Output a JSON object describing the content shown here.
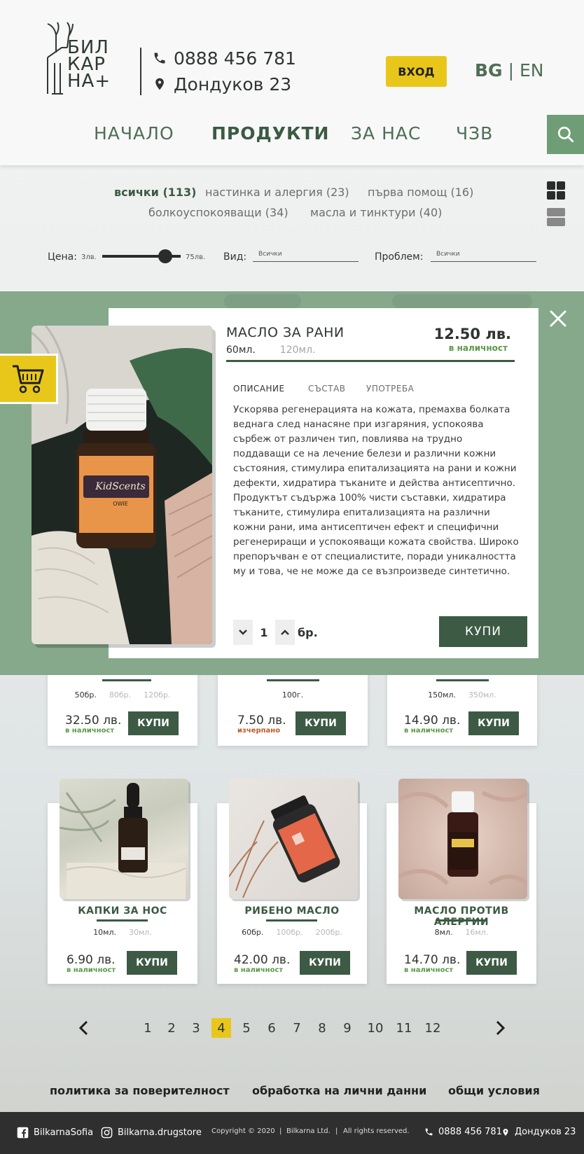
{
  "header": {
    "logo_text": [
      "БИЛ",
      "КАР",
      "НА+"
    ],
    "phone": "0888 456 781",
    "address": "Дондуков 23",
    "login_label": "ВХОД",
    "lang_bg": "BG",
    "lang_sep": "|",
    "lang_en": "EN"
  },
  "nav": {
    "items": [
      {
        "label": "НАЧАЛО"
      },
      {
        "label": "ПРОДУКТИ"
      },
      {
        "label": "ЗА НАС"
      },
      {
        "label": "ЧЗВ"
      }
    ]
  },
  "categories": [
    {
      "label": "всички (113)"
    },
    {
      "label": "настинка и алергия (23)"
    },
    {
      "label": "първа помощ (16)"
    },
    {
      "label": "болкоуспокояващи (34)"
    },
    {
      "label": "масла и тинктури (40)"
    }
  ],
  "filters": {
    "price_label": "Цена:",
    "price_min": "3лв.",
    "price_max": "75лв.",
    "price_level": 0.8,
    "type_label": "Вид:",
    "type_value": "Всички",
    "problem_label": "Проблем:",
    "problem_value": "Всички"
  },
  "products_row1": [
    {
      "sizes": [
        "50бр.",
        "80бр.",
        "120бр."
      ],
      "price": "32.50 лв.",
      "stock": "в наличност",
      "buy": "КУПИ"
    },
    {
      "sizes": [
        "100г."
      ],
      "price": "7.50 лв.",
      "stock": "изчерпано",
      "buy": "КУПИ"
    },
    {
      "sizes": [
        "150мл.",
        "350мл."
      ],
      "price": "14.90 лв.",
      "stock": "в наличност",
      "buy": "КУПИ"
    }
  ],
  "products_row2": [
    {
      "name": "КАПКИ ЗА НОС",
      "sizes": [
        "10мл.",
        "30мл."
      ],
      "price": "6.90 лв.",
      "stock": "в наличност",
      "buy": "КУПИ"
    },
    {
      "name": "РИБЕНО МАСЛО",
      "sizes": [
        "60бр.",
        "100бр.",
        "200бр."
      ],
      "price": "42.00 лв.",
      "stock": "в наличност",
      "buy": "КУПИ"
    },
    {
      "name": "МАСЛО ПРОТИВ АЛЕРГИИ",
      "sizes": [
        "8мл.",
        "16мл."
      ],
      "price": "14.70 лв.",
      "stock": "в наличност",
      "buy": "КУПИ"
    }
  ],
  "modal": {
    "title": "МАСЛО ЗА РАНИ",
    "price": "12.50 лв.",
    "stock": "в наличност",
    "size_selected": "60мл.",
    "size_other": "120мл.",
    "tabs": [
      {
        "label": "ОПИСАНИЕ"
      },
      {
        "label": "СЪСТАВ"
      },
      {
        "label": "УПОТРЕБА"
      }
    ],
    "description": "Ускорява регенерацията на кожата, премахва болката веднага след нанасяне при изгаряния, успокоява сърбеж от различен тип, повлиява на трудно поддаващи се на лечение белези и различни кожни състояния, стимулира епитализацията на рани и кожни дефекти, хидратира тъканите и действа антисептично. Продуктът съдържа 100% чисти съставки, хидратира тъканите, стимулира епитализацията на различни кожни рани, има антисептичен ефект и специфични регенериращи и успокояващи кожата свойства. Широко препоръчван е от специалистите, поради уникалността му и това, че не може да се възпроизведе синтетично.",
    "quantity": "1",
    "unit": "бр.",
    "buy_label": "КУПИ",
    "bottle_brand": "KidScents",
    "bottle_name": "OWIE"
  },
  "pagination": {
    "pages": [
      "1",
      "2",
      "3",
      "4",
      "5",
      "6",
      "7",
      "8",
      "9",
      "10",
      "11",
      "12"
    ],
    "current": "4"
  },
  "footer": {
    "links": [
      {
        "label": "политика за поверителност"
      },
      {
        "label": "обработка на лични данни"
      },
      {
        "label": "общи условия"
      }
    ],
    "facebook": "BilkarnaSofia",
    "instagram": "Bilkarna.drugstore",
    "copyright": "Copyright © 2020",
    "company": "Bilkarna Ltd.",
    "rights": "All rights reserved.",
    "phone": "0888 456 781",
    "address": "Дондуков 23",
    "sep": "|"
  },
  "colors": {
    "accent_yellow": "#e8c71a",
    "brand_green": "#3c5a44",
    "overlay_green": "#86a88b",
    "stock_green": "#5a9a47",
    "out_of_stock": "#c05a2b"
  }
}
